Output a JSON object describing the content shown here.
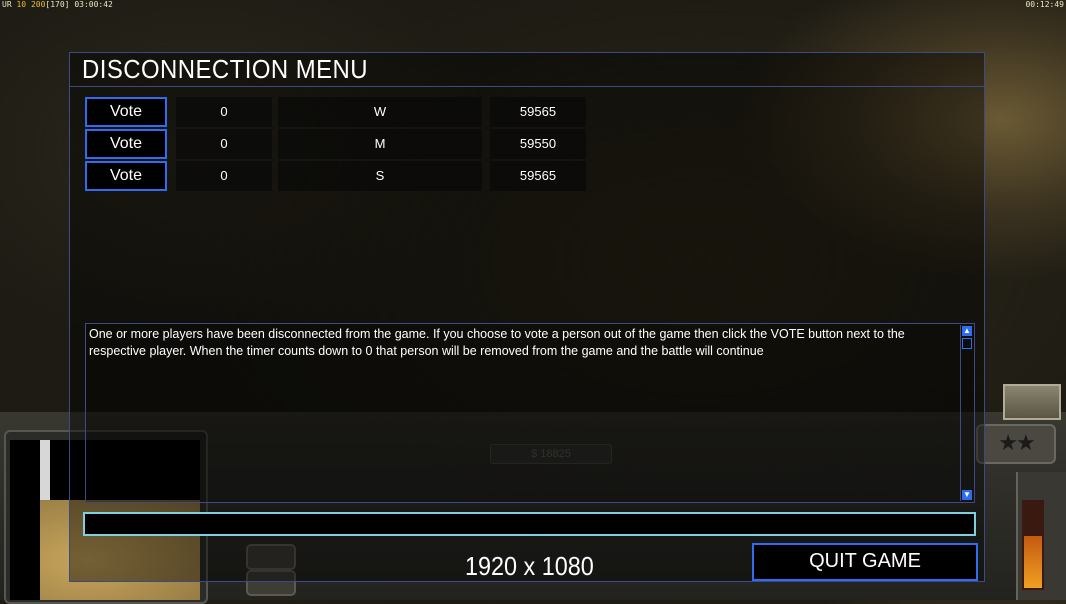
{
  "overlay": {
    "top_left_prefix": "UR",
    "top_left_fps": "10",
    "top_left_limit": "200",
    "top_left_frame": "[170]",
    "top_left_time": "03:00:42",
    "top_right_clock": "00:12:49"
  },
  "hud": {
    "credits": "$ 18825",
    "rank_stars": "★★",
    "power_level": 0.6
  },
  "dialog": {
    "title": "DISCONNECTION MENU",
    "players": [
      {
        "vote_label": "Vote",
        "votes": "0",
        "name": "W",
        "timer": "59565"
      },
      {
        "vote_label": "Vote",
        "votes": "0",
        "name": "M",
        "timer": "59550"
      },
      {
        "vote_label": "Vote",
        "votes": "0",
        "name": "S",
        "timer": "59565"
      }
    ],
    "message": "One or more players have been disconnected from the game. If you choose to vote a person out of the game then click the VOTE button next to the respective player. When the timer counts down to 0 that person will be removed from the game and the battle will continue",
    "chat_value": "",
    "resolution": "1920 x 1080",
    "quit_label": "QUIT GAME"
  },
  "colors": {
    "button_border": "#2f6cf0",
    "frame_border": "#3c4a88",
    "input_border": "#7cd0e0"
  },
  "icons": {
    "scroll_up": "triangle-up-icon",
    "scroll_down": "triangle-down-icon"
  }
}
